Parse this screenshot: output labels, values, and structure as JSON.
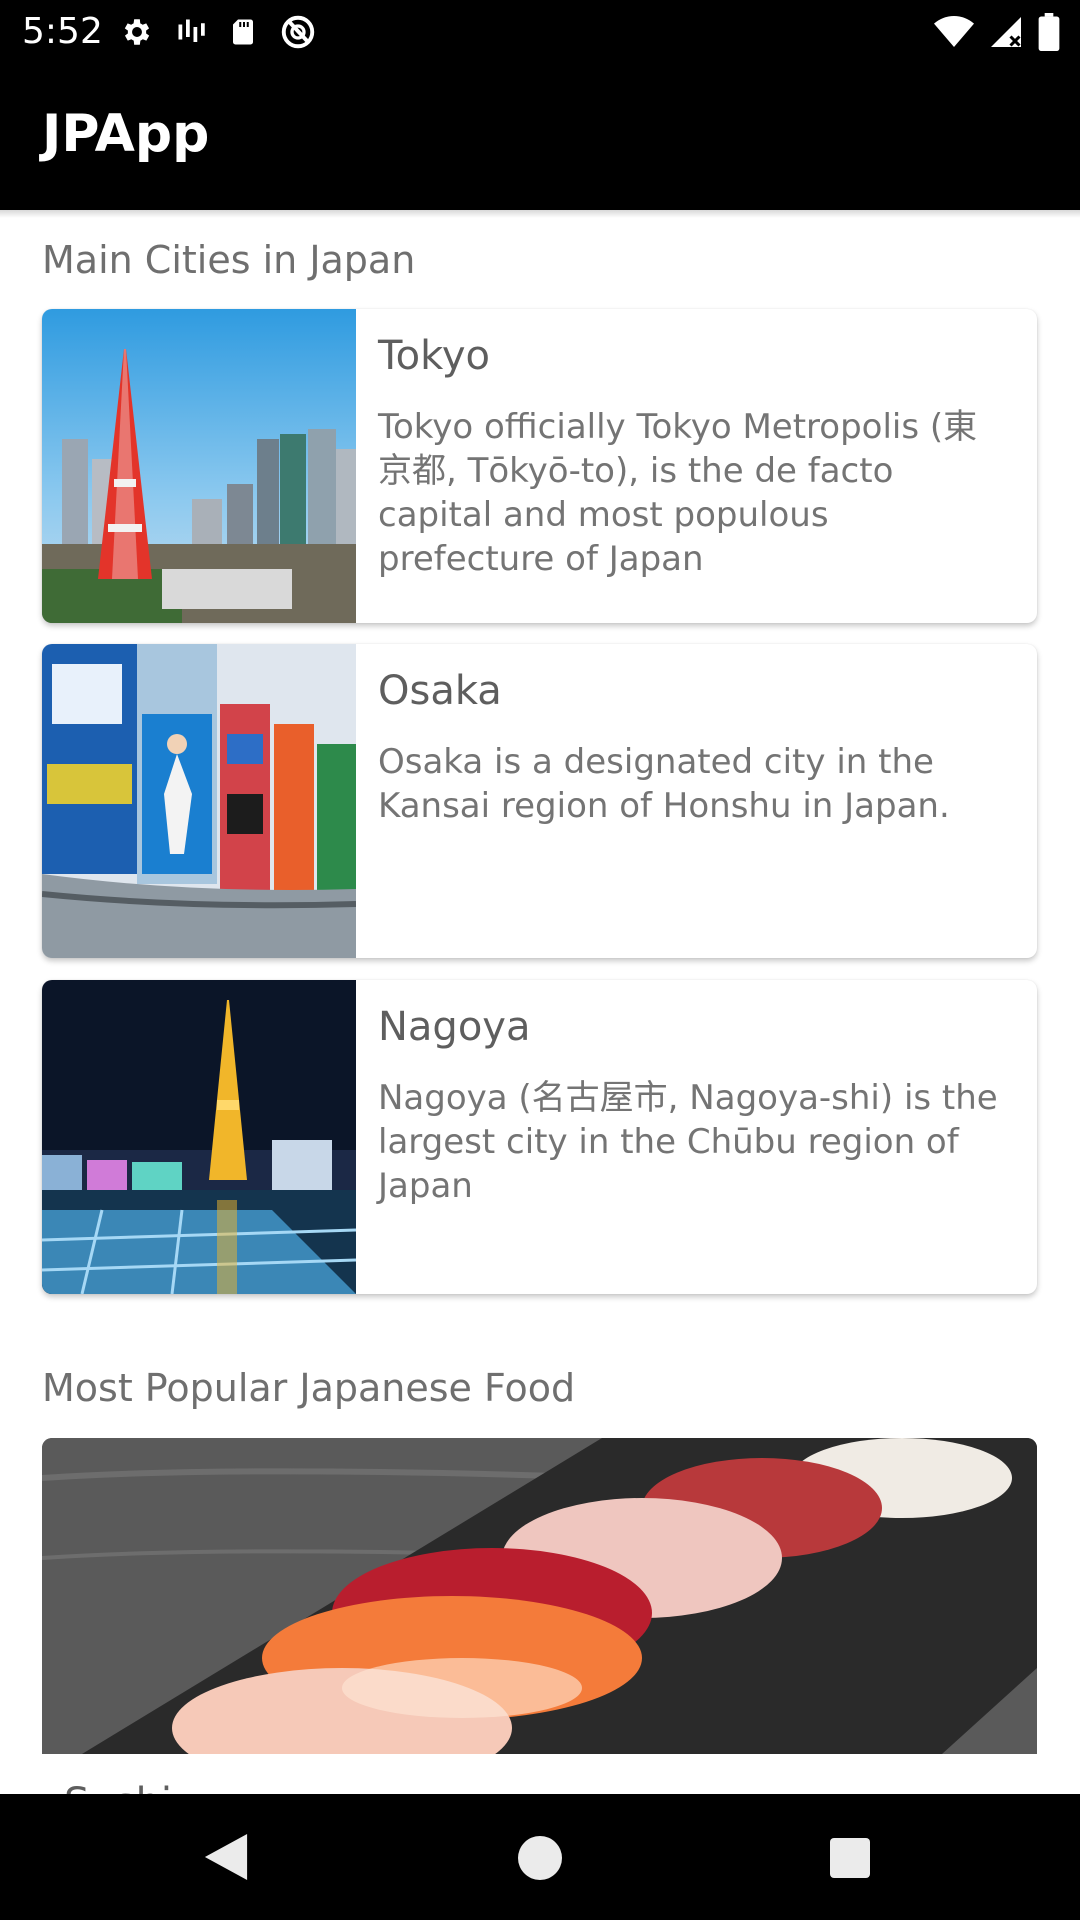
{
  "status_bar": {
    "time": "5:52",
    "left_icons": [
      "gear-icon",
      "signal-bars-icon",
      "sd-card-icon",
      "do-not-disturb-icon"
    ],
    "right_icons": [
      "wifi-icon",
      "cellular-icon",
      "battery-icon"
    ]
  },
  "app_bar": {
    "title": "JPApp"
  },
  "cities_section": {
    "title": "Main Cities in Japan",
    "cities": [
      {
        "name": "Tokyo",
        "description": "Tokyo officially Tokyo Metropolis (東京都, Tōkyō-to), is the de facto capital and most populous prefecture of Japan",
        "image": "tokyo-tower-skyline"
      },
      {
        "name": "Osaka",
        "description": "Osaka is a designated city in the Kansai region of Honshu in Japan.",
        "image": "osaka-dotonbori-signs"
      },
      {
        "name": "Nagoya",
        "description": "Nagoya (名古屋市, Nagoya-shi) is the largest city in the Chūbu region of Japan",
        "image": "nagoya-tv-tower-night"
      }
    ]
  },
  "food_section": {
    "title": "Most Popular Japanese Food",
    "items": [
      {
        "name": "Sushi",
        "image": "sushi-plate"
      }
    ]
  },
  "nav_bar": {
    "buttons": [
      "back-icon",
      "home-icon",
      "recents-icon"
    ]
  },
  "colors": {
    "bars": "#000000",
    "section_title": "#6f6f6f",
    "card_title": "#5e5e5e",
    "card_text": "#747474"
  }
}
